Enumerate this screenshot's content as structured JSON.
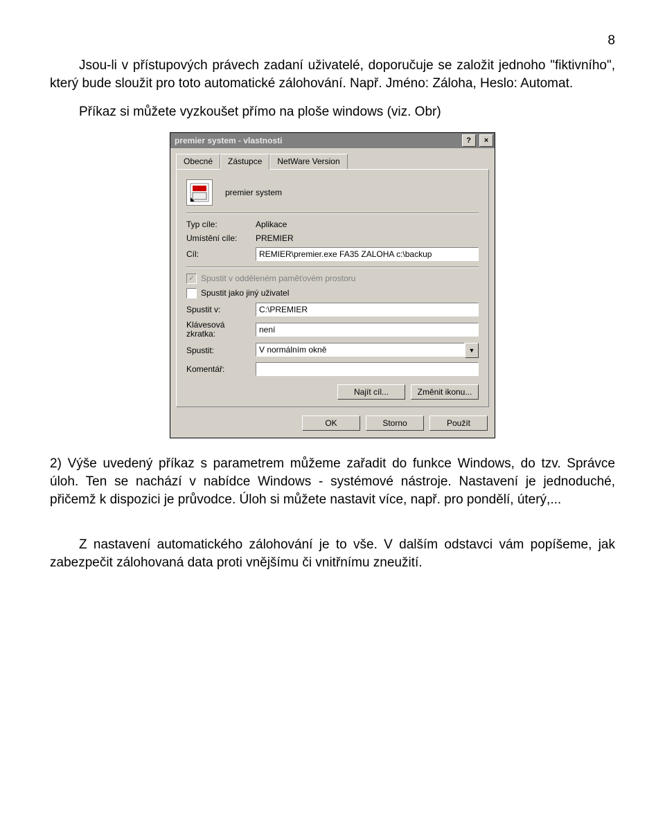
{
  "page_number": "8",
  "para1": "Jsou-li v přístupových právech zadaní uživatelé, doporučuje se založit jednoho \"fiktivního\", který bude sloužit pro toto automatické zálohování. Např. Jméno: Záloha, Heslo: Automat.",
  "para2": "Příkaz si můžete vyzkoušet přímo na ploše windows (viz. Obr)",
  "para3": "2) Výše uvedený příkaz s parametrem můžeme zařadit do funkce Windows, do tzv. Správce úloh. Ten se nachází v nabídce Windows - systémové nástroje. Nastavení je jednoduché, přičemž k dispozici je průvodce. Úloh si můžete nastavit více, např. pro pondělí, úterý,...",
  "para4": "Z nastavení automatického zálohování je to vše. V dalším odstavci vám popíšeme, jak zabezpečit zálohovaná data proti vnějšímu či vnitřnímu zneužití.",
  "dialog": {
    "title": "premier  system - vlastnosti",
    "help_btn": "?",
    "close_btn": "×",
    "tabs": {
      "general": "Obecné",
      "shortcut": "Zástupce",
      "netware": "NetWare Version"
    },
    "app_name": "premier  system",
    "rows": {
      "target_type_lbl": "Typ cíle:",
      "target_type_val": "Aplikace",
      "target_loc_lbl": "Umístění cíle:",
      "target_loc_val": "PREMIER",
      "target_lbl": "Cíl:",
      "target_val": "REMIER\\premier.exe FA35 ZALOHA c:\\backup",
      "sep_mem": "Spustit v odděleném paměťovém prostoru",
      "run_as": "Spustit jako jiný uživatel",
      "start_in_lbl": "Spustit v:",
      "start_in_val": "C:\\PREMIER",
      "hotkey_lbl": "Klávesová zkratka:",
      "hotkey_val": "není",
      "run_lbl": "Spustit:",
      "run_val": "V normálním okně",
      "comment_lbl": "Komentář:"
    },
    "buttons": {
      "find_target": "Najít cíl...",
      "change_icon": "Změnit ikonu...",
      "ok": "OK",
      "cancel": "Storno",
      "apply": "Použít"
    }
  }
}
